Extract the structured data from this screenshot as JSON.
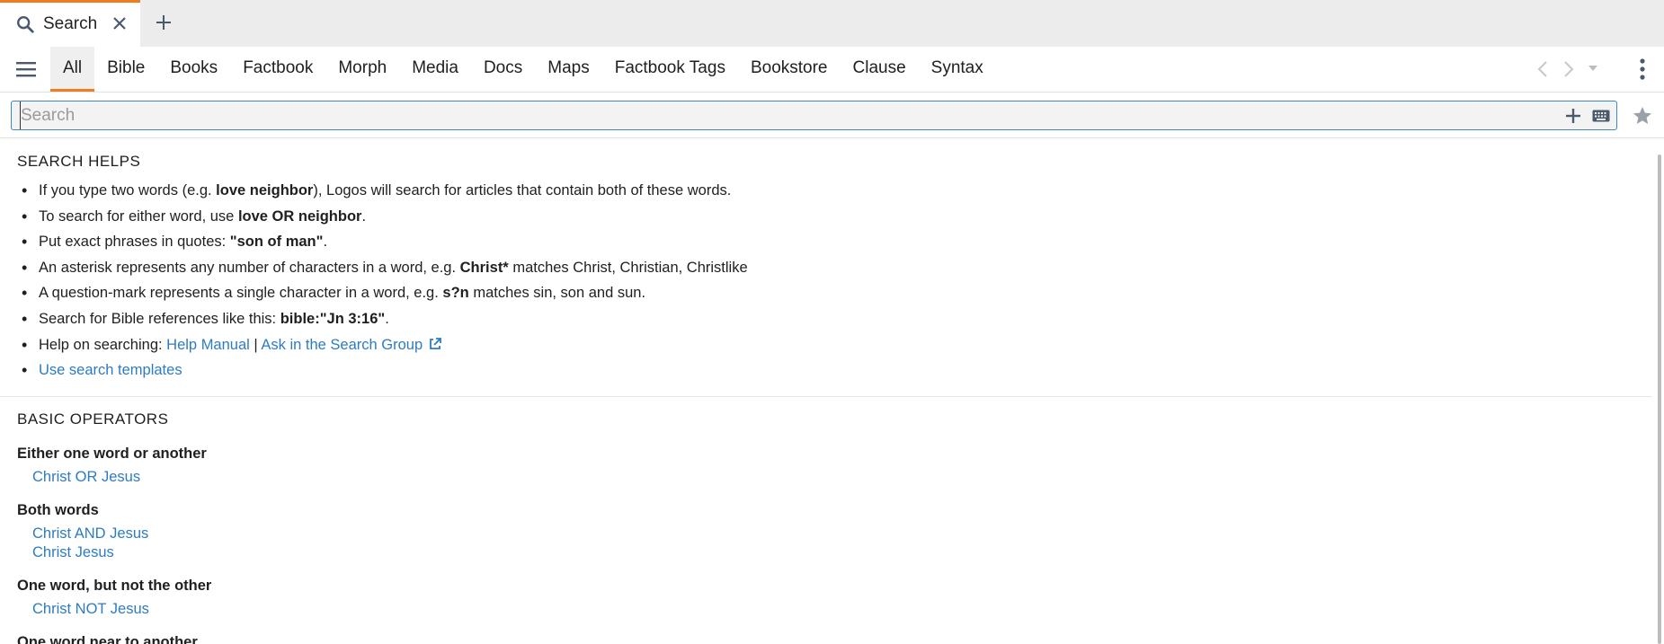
{
  "tab": {
    "title": "Search",
    "icon": "search-icon"
  },
  "nav": {
    "tabs": [
      "All",
      "Bible",
      "Books",
      "Factbook",
      "Morph",
      "Media",
      "Docs",
      "Maps",
      "Factbook Tags",
      "Bookstore",
      "Clause",
      "Syntax"
    ],
    "active_tab": "All"
  },
  "search": {
    "placeholder": "Search",
    "value": ""
  },
  "helps": {
    "title": "SEARCH HELPS",
    "items": {
      "i0": {
        "a": "If you type two words (e.g. ",
        "b": "love neighbor",
        "c": "), Logos will search for articles that contain both of these words."
      },
      "i1": {
        "a": "To search for either word, use ",
        "b": "love OR neighbor",
        "c": "."
      },
      "i2": {
        "a": "Put exact phrases in quotes: ",
        "b": "\"son of man\"",
        "c": "."
      },
      "i3": {
        "a": "An asterisk represents any number of characters in a word, e.g. ",
        "b": "Christ*",
        "c": " matches Christ, Christian, Christlike"
      },
      "i4": {
        "a": "A question-mark represents a single character in a word, e.g. ",
        "b": "s?n",
        "c": " matches sin, son and sun."
      },
      "i5": {
        "a": "Search for Bible references like this: ",
        "b": "bible:\"Jn 3:16\"",
        "c": "."
      },
      "i6": {
        "a": "Help on searching: ",
        "link1": "Help Manual",
        "sep": " | ",
        "link2": "Ask in the Search Group"
      },
      "i7": {
        "link": "Use search templates"
      }
    }
  },
  "operators": {
    "title": "BASIC OPERATORS",
    "groups": [
      {
        "heading": "Either one word or another",
        "examples": [
          "Christ OR Jesus"
        ]
      },
      {
        "heading": "Both words",
        "examples": [
          "Christ AND Jesus",
          "Christ Jesus"
        ]
      },
      {
        "heading": "One word, but not the other",
        "examples": [
          "Christ NOT Jesus"
        ]
      },
      {
        "heading": "One word near to another",
        "examples": []
      }
    ]
  },
  "colors": {
    "accent": "#f07d1f",
    "link": "#2d7cc0",
    "search_border": "#3f86c4"
  }
}
